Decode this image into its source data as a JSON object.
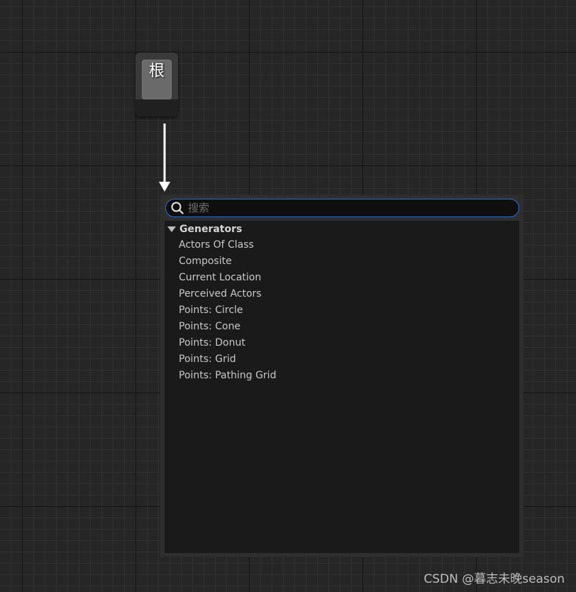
{
  "root_node": {
    "label": "根"
  },
  "search": {
    "placeholder": "搜索",
    "value": ""
  },
  "menu": {
    "category": {
      "label": "Generators",
      "expanded": true
    },
    "items": [
      {
        "label": "Actors Of Class"
      },
      {
        "label": "Composite"
      },
      {
        "label": "Current Location"
      },
      {
        "label": "Perceived Actors"
      },
      {
        "label": "Points: Circle"
      },
      {
        "label": "Points: Cone"
      },
      {
        "label": "Points: Donut"
      },
      {
        "label": "Points: Grid"
      },
      {
        "label": "Points: Pathing Grid"
      }
    ]
  },
  "icons": {
    "search": "search-icon",
    "expand": "triangle-down-icon"
  },
  "colors": {
    "background": "#262626",
    "search_border": "#2a6fd6",
    "list_background": "#1a1a1a"
  },
  "watermark": "CSDN @暮志未晚season"
}
